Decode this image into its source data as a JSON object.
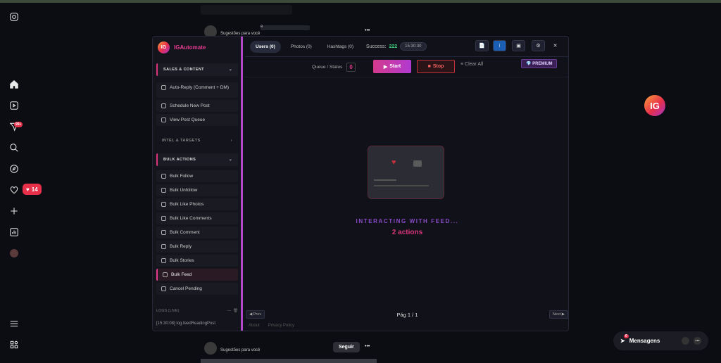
{
  "feed": {
    "top_author_obfuscated": "e",
    "top_suggest": "Sugestões para você",
    "bottom_suggest": "Sugestões para você",
    "follow_label": "Seguir",
    "more_dots": "•••"
  },
  "rail": {
    "notif_badge": "99+",
    "likes_count": "14",
    "items": [
      "instagram-icon",
      "home-icon",
      "reels-icon",
      "send-icon",
      "search-icon",
      "explore-icon",
      "heart-icon",
      "create-icon",
      "dashboard-icon",
      "profile-icon",
      "menu-icon",
      "apps-icon"
    ]
  },
  "panel": {
    "brand": "IGAutomate",
    "brand_logo": "IG",
    "tabs": [
      "Users (0)",
      "Photos (0)",
      "Hashtags (0)"
    ],
    "success_label": "Success:",
    "success_count": "222",
    "time": "15:30:30",
    "queue_label": "Queue / Status",
    "queue_value": "0",
    "start_label": "Start",
    "stop_label": "Stop",
    "clear_label": "Clear All",
    "premium_label": "PREMIUM",
    "sections": {
      "sales": "SALES & CONTENT",
      "intel": "INTEL & TARGETS",
      "bulk": "BULK ACTIONS"
    },
    "sales_items": [
      "Auto-Reply (Comment + DM)",
      "Schedule New Post",
      "View Post Queue"
    ],
    "bulk_items": [
      "Bulk Follow",
      "Bulk Unfollow",
      "Bulk Like Photos",
      "Bulk Like Comments",
      "Bulk Comment",
      "Bulk Reply",
      "Bulk Stories",
      "Bulk Feed",
      "Cancel Pending"
    ],
    "logs_label": "LOGS (LIVE)",
    "log_line": "[15:30:08] log.feedReadingPost",
    "status_title": "INTERACTING WITH FEED...",
    "status_count": "2 actions",
    "prev": "◀ Prev",
    "next": "Next ▶",
    "page": "Pág 1 / 1",
    "footer": [
      "About",
      "Privacy Policy"
    ]
  },
  "floating_logo": "IG",
  "messages": {
    "label": "Mensagens",
    "badge": "0"
  }
}
